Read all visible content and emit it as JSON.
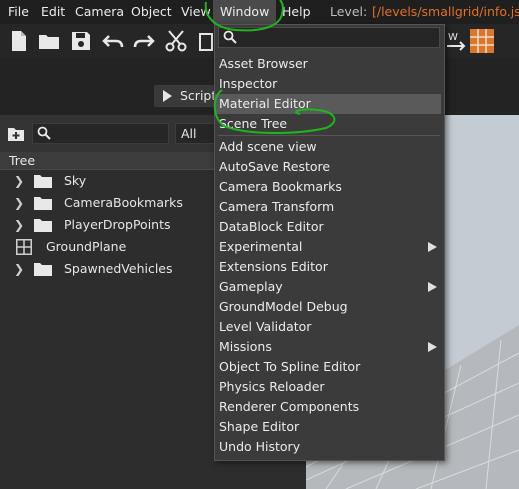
{
  "menubar": {
    "items": [
      "File",
      "Edit",
      "Camera",
      "Object",
      "View",
      "Window",
      "Help"
    ],
    "level_label": "Level:",
    "level_path": "[/levels/smallgrid/info.json"
  },
  "toolbar": {
    "icons": [
      "new-file-icon",
      "open-folder-icon",
      "save-icon",
      "undo-icon",
      "redo-icon",
      "cut-icon",
      "copy-icon"
    ],
    "script_label": "Script"
  },
  "scene_panel": {
    "filter_value": "All",
    "tree_header": "Tree",
    "items": [
      {
        "label": "Sky",
        "type": "folder"
      },
      {
        "label": "CameraBookmarks",
        "type": "folder"
      },
      {
        "label": "PlayerDropPoints",
        "type": "folder"
      },
      {
        "label": "GroundPlane",
        "type": "object"
      },
      {
        "label": "SpawnedVehicles",
        "type": "folder"
      }
    ]
  },
  "window_menu": {
    "search_placeholder": "",
    "top_items": [
      "Asset Browser",
      "Inspector",
      "Material Editor",
      "Scene Tree"
    ],
    "highlighted": "Material Editor",
    "items": [
      {
        "label": "Add scene view",
        "submenu": false
      },
      {
        "label": "AutoSave Restore",
        "submenu": false
      },
      {
        "label": "Camera Bookmarks",
        "submenu": false
      },
      {
        "label": "Camera Transform",
        "submenu": false
      },
      {
        "label": "DataBlock Editor",
        "submenu": false
      },
      {
        "label": "Experimental",
        "submenu": true
      },
      {
        "label": "Extensions Editor",
        "submenu": false
      },
      {
        "label": "Gameplay",
        "submenu": true
      },
      {
        "label": "GroundModel Debug",
        "submenu": false
      },
      {
        "label": "Level Validator",
        "submenu": false
      },
      {
        "label": "Missions",
        "submenu": true
      },
      {
        "label": "Object To Spline Editor",
        "submenu": false
      },
      {
        "label": "Physics Reloader",
        "submenu": false
      },
      {
        "label": "Renderer Components",
        "submenu": false
      },
      {
        "label": "Shape Editor",
        "submenu": false
      },
      {
        "label": "Undo History",
        "submenu": false
      }
    ]
  },
  "colors": {
    "accent_path": "#e0702a",
    "annotation": "#1fb51f",
    "highlight": "#5a5a5a"
  }
}
